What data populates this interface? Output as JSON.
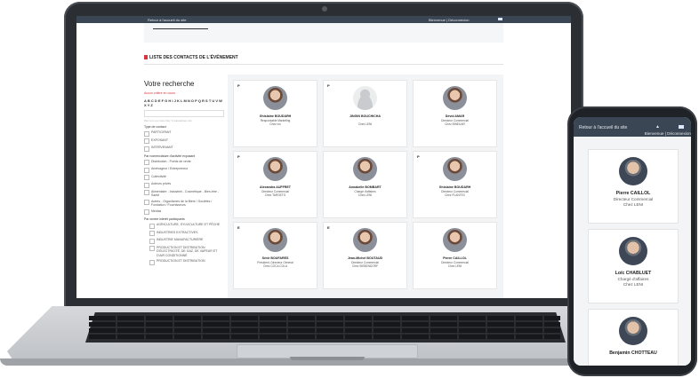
{
  "topbar": {
    "back_link": "Retour à l'accueil du site",
    "user_links": "Bienvenue | Déconnexion"
  },
  "section": {
    "title": "LISTE DES CONTACTS DE L'ÉVÉNEMENT"
  },
  "sidebar": {
    "title": "Votre recherche",
    "no_criteria": "Aucun critère en cours",
    "alphabet": "A B C D E F G H I J K L M N O P Q R S T U V W X Y Z",
    "input_hint": "Par nom ou mots clés / 3 caractères min",
    "type_label": "Type de contact",
    "types": [
      "PARTICIPANT",
      "EXPOSANT",
      "INTERVENANT"
    ],
    "sector_label": "Par nomenclature d'activité exposant",
    "sectors": [
      "Distribution - Points de vente",
      "Aménageur / Entrepreneur",
      "Collectivité",
      "Acteurs privés",
      "Alimentaire - Industriel - Cosmétique - Bien-être - Santé",
      "Autres - Organismes de la filière / Sociétés / Fondation / Fournisseurs",
      "Médias"
    ],
    "interest_label": "Par centre intérêt participants",
    "interests": [
      "AGRICULTURE, SYLVICULTURE ET PÊCHE",
      "INDUSTRIES EXTRACTIVES",
      "INDUSTRIE MANUFACTURIÈRE",
      "PRODUCTION ET DISTRIBUTION D'ÉLECTRICITÉ, DE GAZ, DE VAPEUR ET D'AIR CONDITIONNÉ",
      "PRODUCTION ET DISTRIBUTION"
    ]
  },
  "contacts": [
    {
      "letter": "P",
      "name": "Ghislaine BOUDARH",
      "role": "Responsable Marketing",
      "company": "Chez lvn",
      "photo": "woman-blonde"
    },
    {
      "letter": "P",
      "name": "JINGIN BOUCHICHA",
      "role": "",
      "company": "Chez LENI",
      "photo": "anonymous"
    },
    {
      "letter": "",
      "name": "Dévid AMAR",
      "role": "Directeur Commercial",
      "company": "Chez BINEUAR",
      "photo": "man-suit"
    },
    {
      "letter": "P",
      "name": "Alexandra AUFFRET",
      "role": "Directeur Commercial",
      "company": "Chez TARGETO",
      "photo": "woman-dark"
    },
    {
      "letter": "",
      "name": "Annabelle BOMBART",
      "role": "Chargé d'affaires",
      "company": "Chez LENI",
      "photo": "woman-smile"
    },
    {
      "letter": "P",
      "name": "Ghislaine BOUDARH",
      "role": "Directeur Commercial",
      "company": "Chez PLANTEX",
      "photo": "woman-curly"
    },
    {
      "letter": "E",
      "name": "Sévir BOUFARES",
      "role": "Président, Directeur Général",
      "company": "Chez COCA COLA",
      "photo": "woman-black"
    },
    {
      "letter": "E",
      "name": "Jean-Michel BOUTAUD",
      "role": "Directeur Commercial",
      "company": "Chez SIEBENDORF",
      "photo": "man-dark"
    },
    {
      "letter": "",
      "name": "Pierre CAILLOL",
      "role": "Directeur Commercial",
      "company": "Chez LENI",
      "photo": "man-grey"
    }
  ],
  "phone": {
    "back_link": "Retour à l'accueil du site",
    "user_links": "Bienvenue | Déconnexion",
    "contacts": [
      {
        "name": "Pierre CAILLOL",
        "role": "Directeur Commercial",
        "company": "Chez LENI"
      },
      {
        "name": "Loïc CHABLUET",
        "role": "Chargé d'affaires",
        "company": "Chez LENI"
      },
      {
        "name": "Benjamin CHOTTEAU",
        "role": "",
        "company": ""
      }
    ]
  },
  "colors": {
    "accent": "#d8343d",
    "topbar": "#3a4654"
  }
}
